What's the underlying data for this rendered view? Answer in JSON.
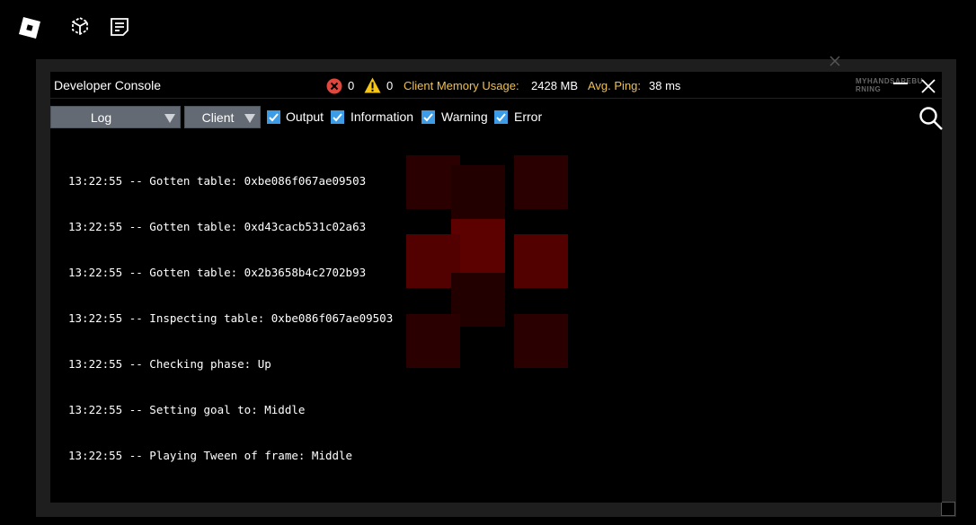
{
  "topbar": {
    "icons": [
      "roblox-logo-icon",
      "avatar-icon",
      "chat-icon"
    ]
  },
  "console": {
    "title": "Developer Console",
    "error_count": "0",
    "warning_count": "0",
    "memory_label": "Client Memory Usage:",
    "memory_value": "2428 MB",
    "ping_label": "Avg. Ping:",
    "ping_value": "38 ms",
    "watermark": "MYHANDSAREBURNING"
  },
  "toolbar": {
    "log_dropdown": "Log",
    "client_dropdown": "Client",
    "filters": [
      {
        "label": "Output",
        "checked": true
      },
      {
        "label": "Information",
        "checked": true
      },
      {
        "label": "Warning",
        "checked": true
      },
      {
        "label": "Error",
        "checked": true
      }
    ]
  },
  "log": {
    "lines": [
      "13:22:55 -- Gotten table: 0xbe086f067ae09503",
      "13:22:55 -- Gotten table: 0xd43cacb531c02a63",
      "13:22:55 -- Gotten table: 0x2b3658b4c2702b93",
      "13:22:55 -- Inspecting table: 0xbe086f067ae09503",
      "13:22:55 -- Checking phase: Up",
      "13:22:55 -- Setting goal to: Middle",
      "13:22:55 -- Playing Tween of frame: Middle"
    ]
  },
  "colors": {
    "accent": "#3c9ce8",
    "stat_label": "#f2c04c",
    "error_red": "#e0463c",
    "warning_yellow": "#f5c518",
    "pattern_dark": "#2a0000",
    "pattern_bright": "#5c0000"
  }
}
